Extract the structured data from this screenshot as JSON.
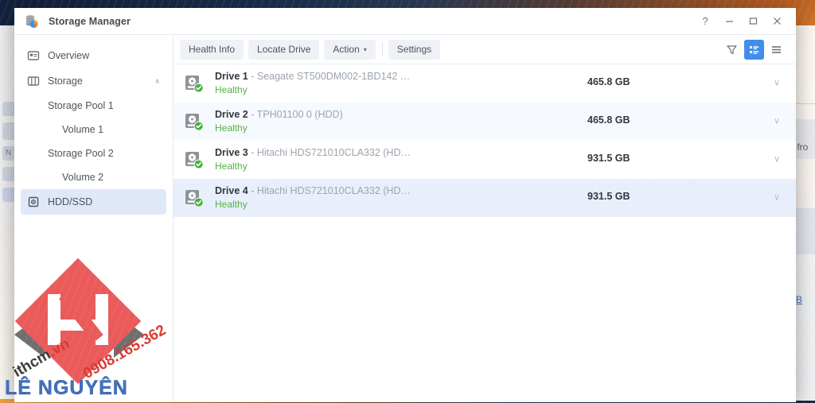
{
  "window": {
    "title": "Storage Manager",
    "icon": "storage-manager-icon",
    "controls": {
      "help": "?",
      "minimize": "—",
      "maximize": "□",
      "close": "✕"
    }
  },
  "sidebar": {
    "items": [
      {
        "label": "Overview",
        "icon": "overview-icon",
        "type": "item",
        "active": false
      },
      {
        "label": "Storage",
        "icon": "storage-icon",
        "type": "item",
        "active": false,
        "caret": "∧"
      },
      {
        "label": "Storage Pool 1",
        "type": "sub",
        "level": 1
      },
      {
        "label": "Volume 1",
        "type": "sub",
        "level": 2
      },
      {
        "label": "Storage Pool 2",
        "type": "sub",
        "level": 1
      },
      {
        "label": "Volume 2",
        "type": "sub",
        "level": 2
      },
      {
        "label": "HDD/SSD",
        "icon": "hdd-ssd-icon",
        "type": "item",
        "active": true
      }
    ]
  },
  "toolbar": {
    "health_info": "Health Info",
    "locate_drive": "Locate Drive",
    "action": "Action",
    "action_caret": "▾",
    "settings": "Settings",
    "filter_icon": "filter-funnel-icon",
    "detail_view_icon": "detail-list-view-icon",
    "list_view_icon": "list-view-icon",
    "active_view": "detail"
  },
  "drives": [
    {
      "name": "Drive 1",
      "model": "- Seagate ST500DM002-1BD142 …",
      "size": "465.8 GB",
      "status": "Healthy",
      "row_style": "plain",
      "chevron": "∨"
    },
    {
      "name": "Drive 2",
      "model": "- TPH01100 0 (HDD)",
      "size": "465.8 GB",
      "status": "Healthy",
      "row_style": "stripe",
      "chevron": "∨"
    },
    {
      "name": "Drive 3",
      "model": "- Hitachi HDS721010CLA332 (HD…",
      "size": "931.5 GB",
      "status": "Healthy",
      "row_style": "plain",
      "chevron": "∨"
    },
    {
      "name": "Drive 4",
      "model": "- Hitachi HDS721010CLA332 (HD…",
      "size": "931.5 GB",
      "status": "Healthy",
      "row_style": "selected",
      "chevron": "∨"
    }
  ],
  "background_windows": {
    "right_snippet_1": "s fro",
    "right_snippet_2": "o B",
    "left_label": "N"
  },
  "watermark": {
    "site_prefix": "ithcm",
    "site_suffix": ".vn",
    "phone": "0908.165.362",
    "brand": "LÊ NGUYÊN"
  },
  "colors": {
    "accent": "#3f8cea",
    "healthy": "#52b043",
    "selected_row": "#e8effb",
    "stripe_row": "#f6f9fd",
    "watermark_red": "#ea5a5a",
    "watermark_blue": "#3f6fbf"
  }
}
